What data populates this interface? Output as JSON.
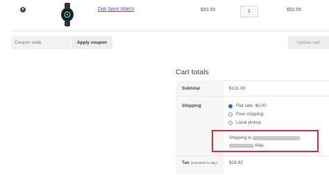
{
  "cart_item": {
    "product_name": "Didi Sport Watch",
    "price": "$92.00",
    "quantity": "1",
    "subtotal": "$92.00",
    "remove_glyph": "×"
  },
  "coupon": {
    "placeholder": "Coupon code",
    "apply_label": "Apply coupon",
    "update_label": "Update cart"
  },
  "totals": {
    "title": "Cart totals",
    "subtotal_label": "Subtotal",
    "subtotal_value": "$131.00",
    "shipping_label": "Shipping",
    "shipping_options": [
      {
        "label": "Flat rate: $5.00",
        "selected": true
      },
      {
        "label": "Free shipping",
        "selected": false
      },
      {
        "label": "Local pickup",
        "selected": false
      }
    ],
    "shipping_to_prefix": "Shipping to",
    "shipping_to_suffix": ",",
    "shipping_country": ", Italy.",
    "tax_label": "Tax",
    "tax_note": "(estimated for Italy)",
    "tax_value": "$29.92"
  },
  "colors": {
    "link": "#6a4bb5",
    "highlight": "#d9323a",
    "radio_selected": "#2a6fd6"
  },
  "icons": {
    "remove": "remove-icon",
    "product": "watch-icon"
  }
}
